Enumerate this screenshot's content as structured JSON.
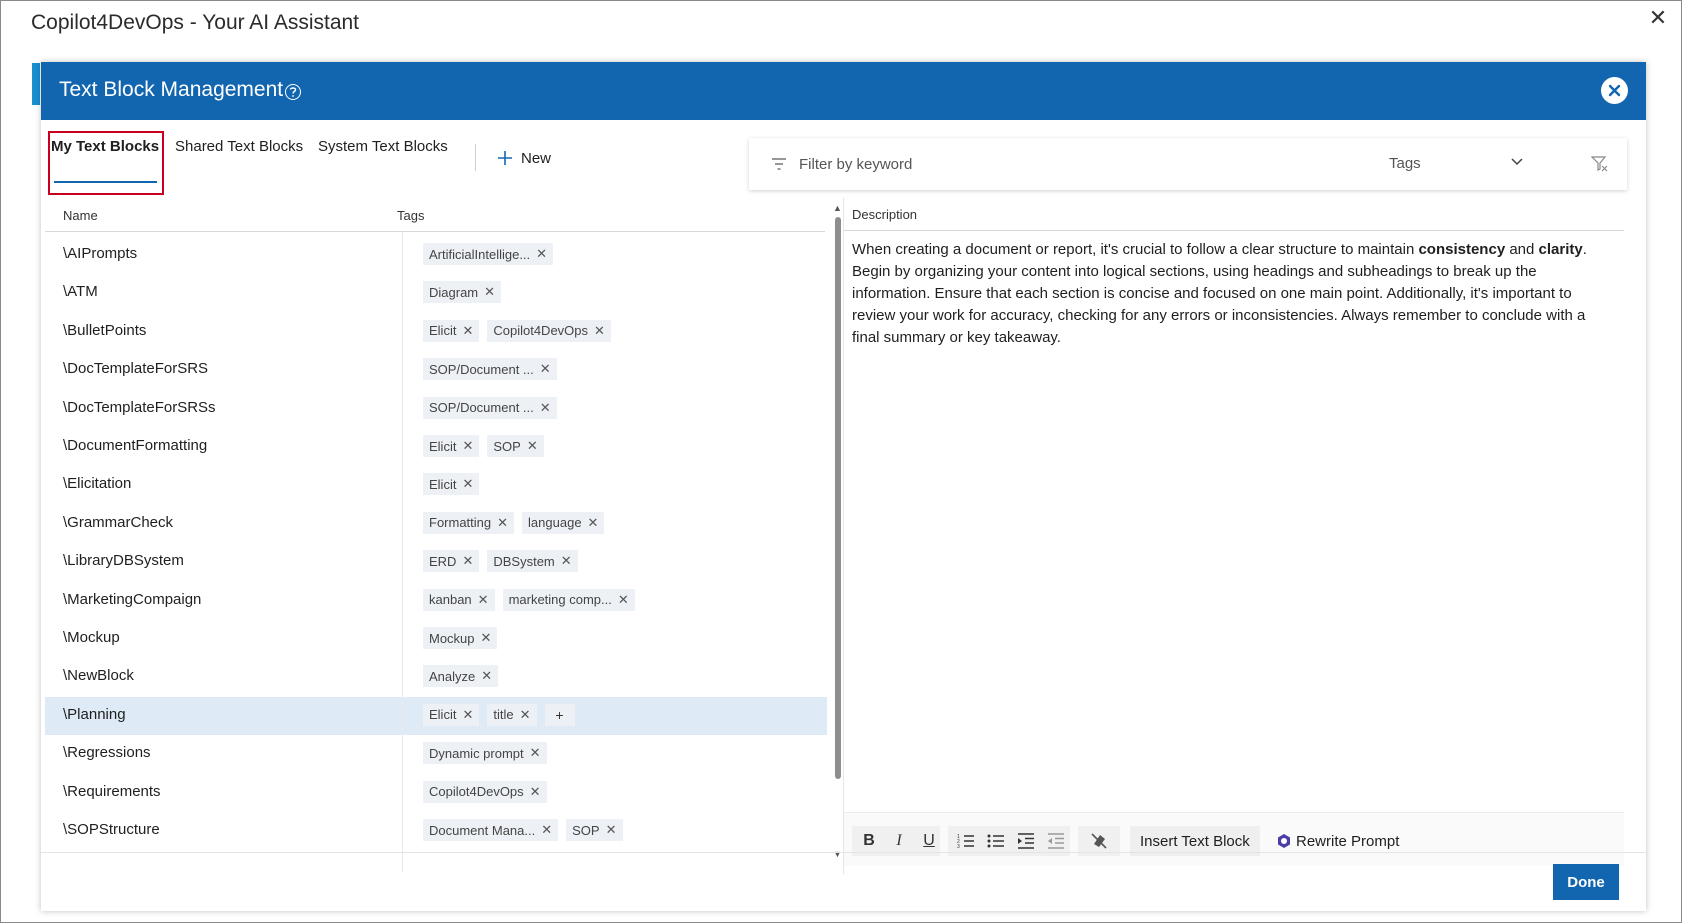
{
  "window": {
    "title": "Copilot4DevOps - Your AI Assistant",
    "close_glyph": "✕"
  },
  "dialog": {
    "title": "Text Block Management",
    "tabs": [
      "My Text Blocks",
      "Shared Text Blocks",
      "System Text Blocks"
    ],
    "new_label": "New"
  },
  "filter": {
    "placeholder": "Filter by keyword",
    "tags_label": "Tags"
  },
  "list": {
    "columns": {
      "name": "Name",
      "tags": "Tags"
    },
    "rows": [
      {
        "name": "\\AIPrompts",
        "tags": [
          "ArtificialIntellige..."
        ]
      },
      {
        "name": "\\ATM",
        "tags": [
          "Diagram"
        ]
      },
      {
        "name": "\\BulletPoints",
        "tags": [
          "Elicit",
          "Copilot4DevOps"
        ]
      },
      {
        "name": "\\DocTemplateForSRS",
        "tags": [
          "SOP/Document ..."
        ]
      },
      {
        "name": "\\DocTemplateForSRSs",
        "tags": [
          "SOP/Document ..."
        ]
      },
      {
        "name": "\\DocumentFormatting",
        "tags": [
          "Elicit",
          "SOP"
        ]
      },
      {
        "name": "\\Elicitation",
        "tags": [
          "Elicit"
        ]
      },
      {
        "name": "\\GrammarCheck",
        "tags": [
          "Formatting",
          "language"
        ]
      },
      {
        "name": "\\LibraryDBSystem",
        "tags": [
          "ERD",
          "DBSystem"
        ]
      },
      {
        "name": "\\MarketingCompaign",
        "tags": [
          "kanban",
          "marketing comp..."
        ]
      },
      {
        "name": "\\Mockup",
        "tags": [
          "Mockup"
        ]
      },
      {
        "name": "\\NewBlock",
        "tags": [
          "Analyze"
        ]
      },
      {
        "name": "\\Planning",
        "tags": [
          "Elicit",
          "title"
        ],
        "selected": true
      },
      {
        "name": "\\Regressions",
        "tags": [
          "Dynamic prompt"
        ]
      },
      {
        "name": "\\Requirements",
        "tags": [
          "Copilot4DevOps"
        ]
      },
      {
        "name": "\\SOPStructure",
        "tags": [
          "Document Mana...",
          "SOP"
        ]
      }
    ]
  },
  "description": {
    "label": "Description",
    "text_1": "When creating a document or report, it's crucial to follow a clear structure to maintain ",
    "bold_1": "consistency",
    "text_2": " and ",
    "bold_2": "clarity",
    "text_3": ". Begin by organizing your content into logical sections, using headings and subheadings to break up the information. Ensure that each section is concise and focused on one main point. Additionally, it's important to review your work for accuracy, checking for any errors or inconsistencies. Always remember to conclude with a final summary or key takeaway."
  },
  "toolbar": {
    "bold": "B",
    "italic": "I",
    "underline": "U",
    "insert_label": "Insert Text Block",
    "rewrite_label": "Rewrite Prompt"
  },
  "footer": {
    "done_label": "Done"
  },
  "colors": {
    "header_blue": "#1266b0",
    "selected_row": "#deebf7",
    "highlight_red": "#c8001e"
  }
}
